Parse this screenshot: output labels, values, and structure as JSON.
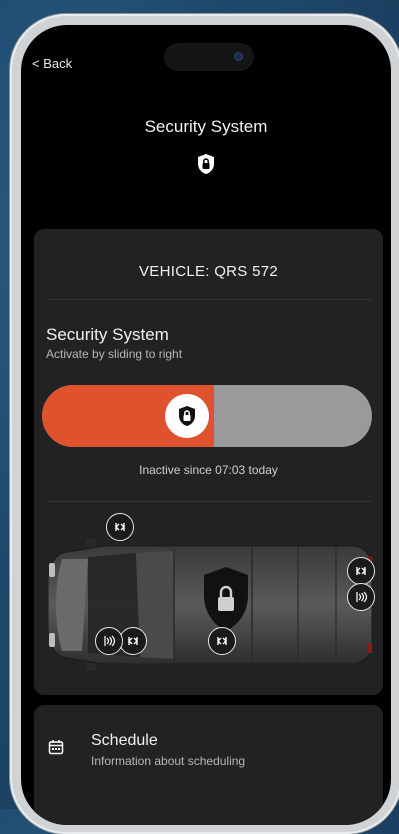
{
  "nav": {
    "back_label": "< Back"
  },
  "header": {
    "title": "Security System",
    "icon": "lock-shield-icon"
  },
  "vehicle": {
    "label": "VEHICLE: QRS 572"
  },
  "security": {
    "title": "Security System",
    "subtitle": "Activate by sliding to right",
    "slider_level": 0.52,
    "status_text": "Inactive since 07:03 today"
  },
  "sensors": [
    {
      "name": "lock-sensor",
      "icon": "lock-sensor-icon"
    },
    {
      "name": "lock-sensor",
      "icon": "lock-sensor-icon"
    },
    {
      "name": "alarm-sensor",
      "icon": "alarm-sensor-icon"
    },
    {
      "name": "alarm-sensor",
      "icon": "alarm-sensor-icon"
    },
    {
      "name": "lock-sensor",
      "icon": "lock-sensor-icon"
    },
    {
      "name": "lock-sensor",
      "icon": "lock-sensor-icon"
    }
  ],
  "schedule": {
    "title": "Schedule",
    "subtitle": "Information about scheduling",
    "icon": "calendar-icon"
  },
  "colors": {
    "accent": "#e0512e",
    "slider_track": "#9a9a9a",
    "card_bg": "#222222",
    "screen_bg": "#000000"
  }
}
